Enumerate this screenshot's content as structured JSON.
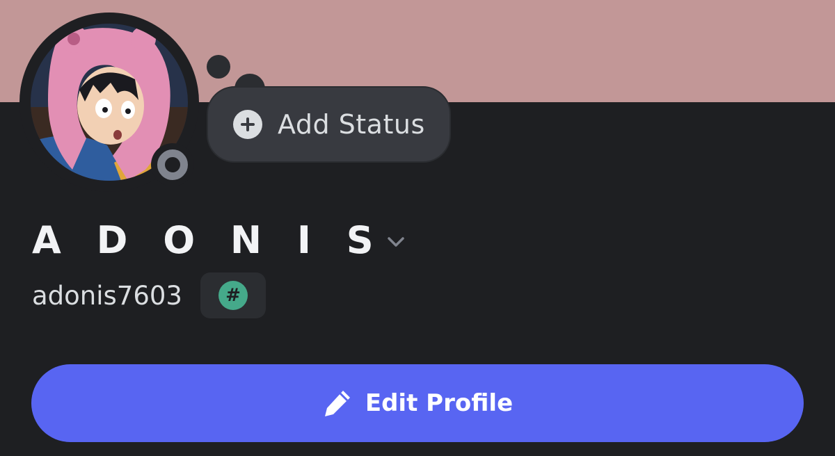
{
  "profile": {
    "banner_color": "#c29797",
    "background_color": "#1e1f22",
    "display_name": "A D O N I S",
    "username": "adonis7603",
    "presence_status": "offline",
    "badge_icon": "hash-icon",
    "badge_symbol": "#"
  },
  "status": {
    "label": "Add Status",
    "icon": "plus-circle-icon"
  },
  "actions": {
    "edit_profile_label": "Edit Profile",
    "edit_icon": "pencil-icon",
    "accent_color": "#5865f2"
  }
}
